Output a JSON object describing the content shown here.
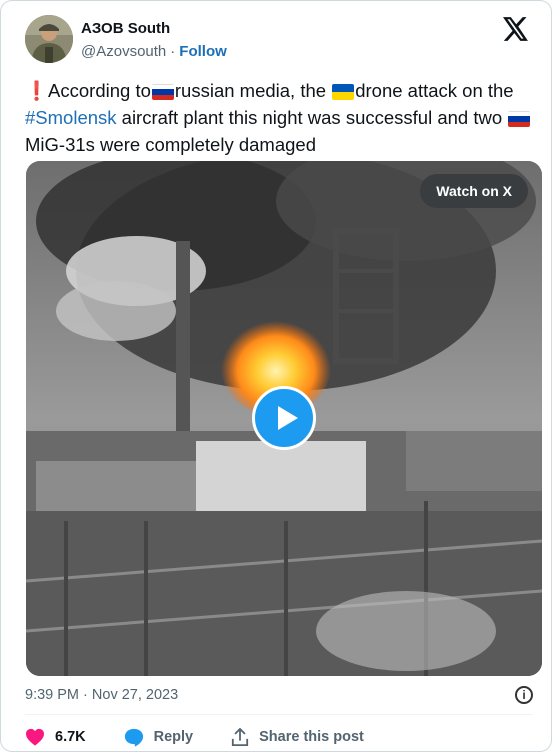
{
  "author": {
    "name": "АЗОВ South",
    "handle": "@Azovsouth",
    "separator": "·",
    "follow_label": "Follow"
  },
  "tweet": {
    "part1": "According to",
    "part2": "russian media, the",
    "part3": "drone attack on the",
    "hashtag": "#Smolensk",
    "part4": "aircraft plant this night was successful and two",
    "part5": "MiG-31s were completely damaged"
  },
  "media": {
    "watch_label": "Watch on X",
    "play_icon": "play-icon"
  },
  "meta": {
    "time": "9:39 PM",
    "separator": "·",
    "date": "Nov 27, 2023",
    "info_icon": "i"
  },
  "actions": {
    "likes": "6.7K",
    "reply_label": "Reply",
    "share_label": "Share this post"
  },
  "colors": {
    "accent": "#1d9bf0",
    "link": "#1d6fb8",
    "like": "#f91880",
    "text": "#0f1419",
    "muted": "#536471"
  }
}
